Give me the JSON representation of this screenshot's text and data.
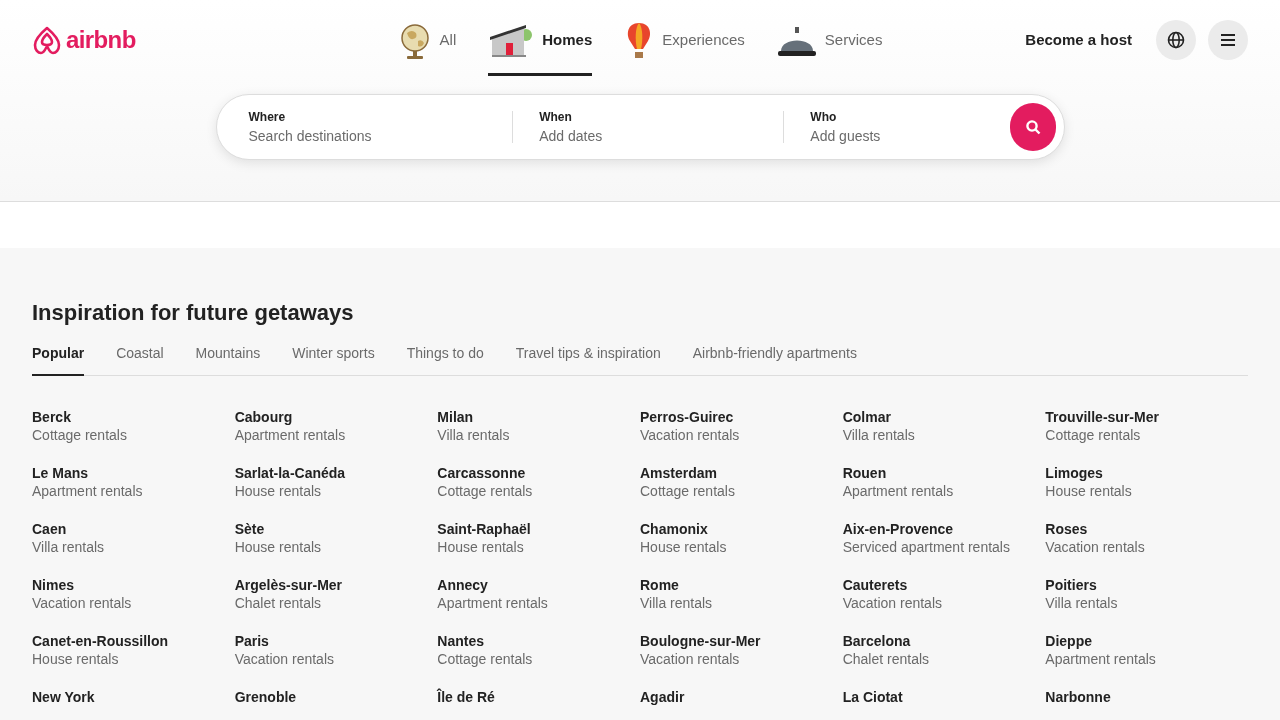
{
  "logo": "airbnb",
  "nav": [
    {
      "label": "All",
      "kind": "globe",
      "selected": false
    },
    {
      "label": "Homes",
      "kind": "house",
      "selected": true
    },
    {
      "label": "Experiences",
      "kind": "balloon",
      "selected": false
    },
    {
      "label": "Services",
      "kind": "bell",
      "selected": false
    }
  ],
  "host_link": "Become a host",
  "search": [
    {
      "label": "Where",
      "placeholder": "Search destinations"
    },
    {
      "label": "When",
      "placeholder": "Add dates"
    },
    {
      "label": "Who",
      "placeholder": "Add guests"
    }
  ],
  "inspiration": {
    "title": "Inspiration for future getaways",
    "tabs": [
      {
        "label": "Popular",
        "selected": true
      },
      {
        "label": "Coastal",
        "selected": false
      },
      {
        "label": "Mountains",
        "selected": false
      },
      {
        "label": "Winter sports",
        "selected": false
      },
      {
        "label": "Things to do",
        "selected": false
      },
      {
        "label": "Travel tips & inspiration",
        "selected": false
      },
      {
        "label": "Airbnb-friendly apartments",
        "selected": false
      }
    ],
    "destinations": [
      {
        "name": "Berck",
        "type": "Cottage rentals"
      },
      {
        "name": "Cabourg",
        "type": "Apartment rentals"
      },
      {
        "name": "Milan",
        "type": "Villa rentals"
      },
      {
        "name": "Perros-Guirec",
        "type": "Vacation rentals"
      },
      {
        "name": "Colmar",
        "type": "Villa rentals"
      },
      {
        "name": "Trouville-sur-Mer",
        "type": "Cottage rentals"
      },
      {
        "name": "Le Mans",
        "type": "Apartment rentals"
      },
      {
        "name": "Sarlat-la-Canéda",
        "type": "House rentals"
      },
      {
        "name": "Carcassonne",
        "type": "Cottage rentals"
      },
      {
        "name": "Amsterdam",
        "type": "Cottage rentals"
      },
      {
        "name": "Rouen",
        "type": "Apartment rentals"
      },
      {
        "name": "Limoges",
        "type": "House rentals"
      },
      {
        "name": "Caen",
        "type": "Villa rentals"
      },
      {
        "name": "Sète",
        "type": "House rentals"
      },
      {
        "name": "Saint-Raphaël",
        "type": "House rentals"
      },
      {
        "name": "Chamonix",
        "type": "House rentals"
      },
      {
        "name": "Aix-en-Provence",
        "type": "Serviced apartment rentals"
      },
      {
        "name": "Roses",
        "type": "Vacation rentals"
      },
      {
        "name": "Nimes",
        "type": "Vacation rentals"
      },
      {
        "name": "Argelès-sur-Mer",
        "type": "Chalet rentals"
      },
      {
        "name": "Annecy",
        "type": "Apartment rentals"
      },
      {
        "name": "Rome",
        "type": "Villa rentals"
      },
      {
        "name": "Cauterets",
        "type": "Vacation rentals"
      },
      {
        "name": "Poitiers",
        "type": "Villa rentals"
      },
      {
        "name": "Canet-en-Roussillon",
        "type": "House rentals"
      },
      {
        "name": "Paris",
        "type": "Vacation rentals"
      },
      {
        "name": "Nantes",
        "type": "Cottage rentals"
      },
      {
        "name": "Boulogne-sur-Mer",
        "type": "Vacation rentals"
      },
      {
        "name": "Barcelona",
        "type": "Chalet rentals"
      },
      {
        "name": "Dieppe",
        "type": "Apartment rentals"
      },
      {
        "name": "New York"
      },
      {
        "name": "Grenoble"
      },
      {
        "name": "Île de Ré"
      },
      {
        "name": "Agadir"
      },
      {
        "name": "La Ciotat"
      },
      {
        "name": "Narbonne"
      }
    ]
  }
}
